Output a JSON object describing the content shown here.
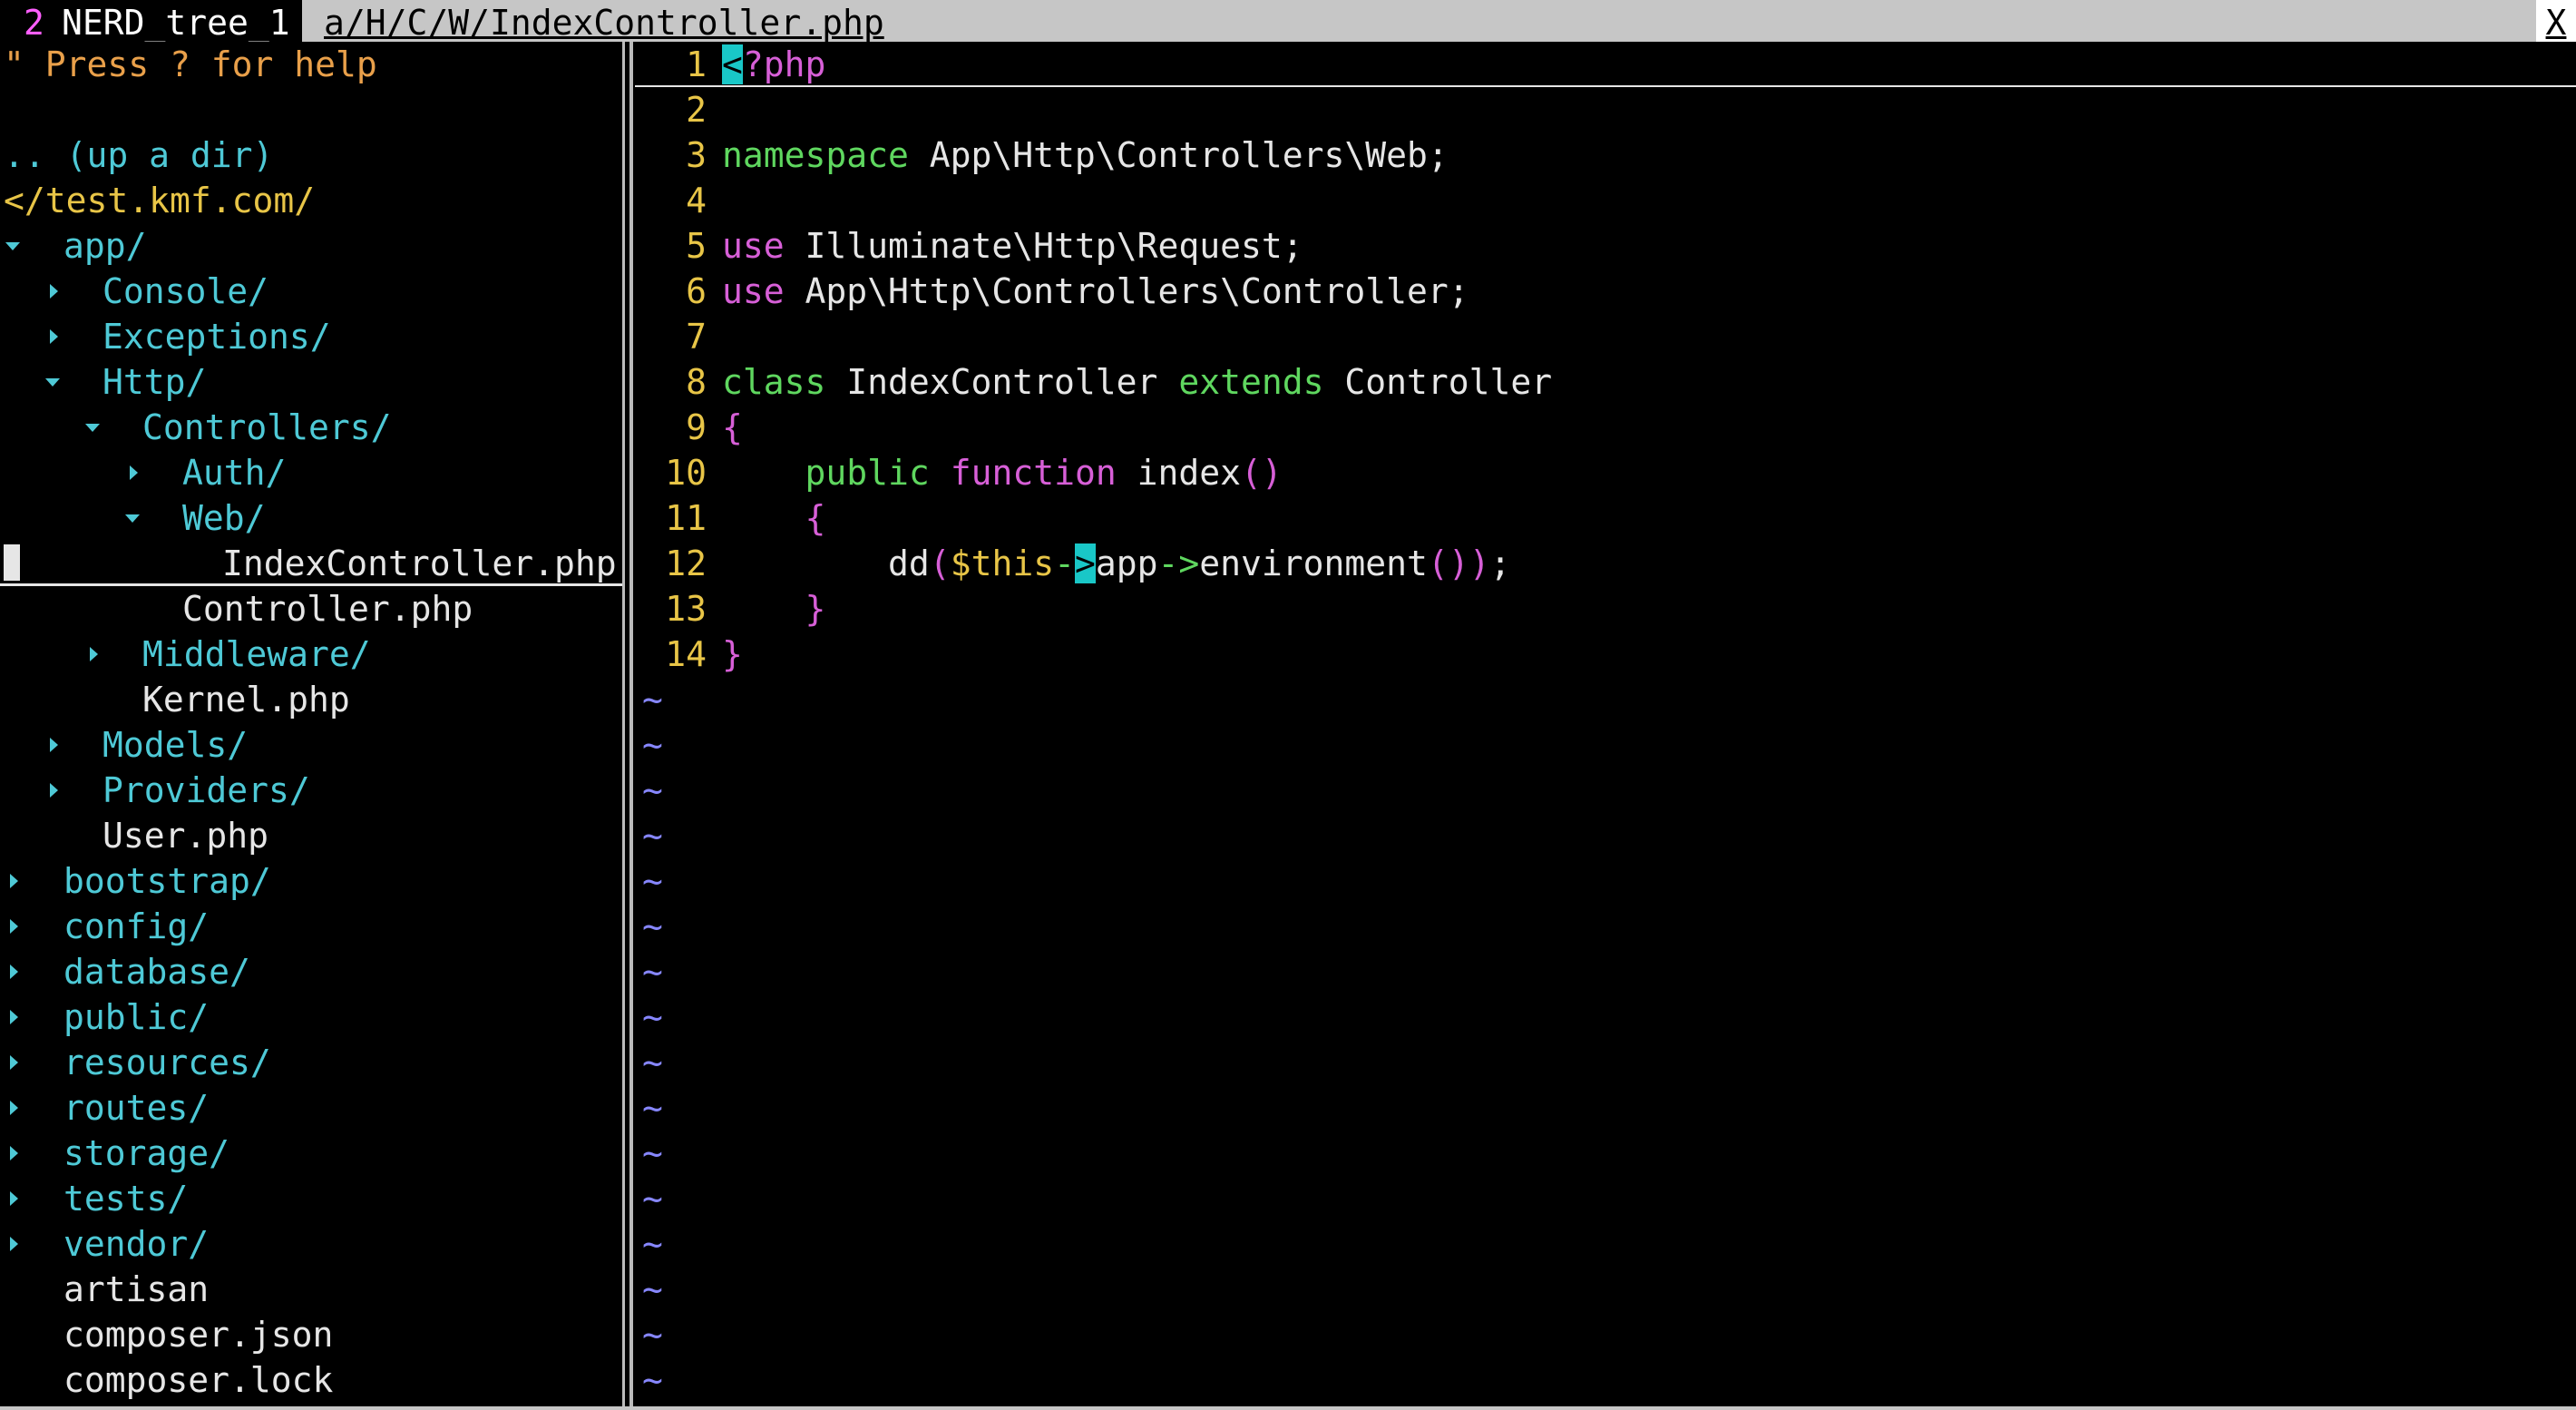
{
  "tabline": {
    "tab1_number": "2",
    "tab1_label": "NERD_tree_1",
    "tab2_label": "a/H/C/W/IndexController.php",
    "close_label": "X"
  },
  "nerdtree": {
    "help": "\" Press ? for help",
    "up_dir": ".. (up a dir)",
    "root": "</test.kmf.com/",
    "items": [
      {
        "label": "app/",
        "type": "dir",
        "state": "open"
      },
      {
        "label": "Console/",
        "type": "dir",
        "state": "closed"
      },
      {
        "label": "Exceptions/",
        "type": "dir",
        "state": "closed"
      },
      {
        "label": "Http/",
        "type": "dir",
        "state": "open"
      },
      {
        "label": "Controllers/",
        "type": "dir",
        "state": "open"
      },
      {
        "label": "Auth/",
        "type": "dir",
        "state": "closed"
      },
      {
        "label": "Web/",
        "type": "dir",
        "state": "open"
      },
      {
        "label": "IndexController.php",
        "type": "file",
        "selected": true
      },
      {
        "label": "Controller.php",
        "type": "file"
      },
      {
        "label": "Middleware/",
        "type": "dir",
        "state": "closed"
      },
      {
        "label": "Kernel.php",
        "type": "file"
      },
      {
        "label": "Models/",
        "type": "dir",
        "state": "closed"
      },
      {
        "label": "Providers/",
        "type": "dir",
        "state": "closed"
      },
      {
        "label": "User.php",
        "type": "file"
      },
      {
        "label": "bootstrap/",
        "type": "dir",
        "state": "closed"
      },
      {
        "label": "config/",
        "type": "dir",
        "state": "closed"
      },
      {
        "label": "database/",
        "type": "dir",
        "state": "closed"
      },
      {
        "label": "public/",
        "type": "dir",
        "state": "closed"
      },
      {
        "label": "resources/",
        "type": "dir",
        "state": "closed"
      },
      {
        "label": "routes/",
        "type": "dir",
        "state": "closed"
      },
      {
        "label": "storage/",
        "type": "dir",
        "state": "closed"
      },
      {
        "label": "tests/",
        "type": "dir",
        "state": "closed"
      },
      {
        "label": "vendor/",
        "type": "dir",
        "state": "closed"
      },
      {
        "label": "artisan",
        "type": "file"
      },
      {
        "label": "composer.json",
        "type": "file"
      },
      {
        "label": "composer.lock",
        "type": "file"
      }
    ]
  },
  "editor": {
    "line_numbers": [
      "1",
      "2",
      "3",
      "4",
      "5",
      "6",
      "7",
      "8",
      "9",
      "10",
      "11",
      "12",
      "13",
      "14"
    ],
    "code": {
      "l1_lt": "<",
      "l1_php": "?php",
      "l3_kw": "namespace",
      "l3_rest": " App\\Http\\Controllers\\Web;",
      "l5_kw": "use",
      "l5_rest": " Illuminate\\Http\\Request;",
      "l6_kw": "use",
      "l6_rest": " App\\Http\\Controllers\\Controller;",
      "l8_kw": "class",
      "l8_name": " IndexController ",
      "l8_ext": "extends",
      "l8_parent": " Controller",
      "l9": "{",
      "l10_indent": "    ",
      "l10_public": "public",
      "l10_sp": " ",
      "l10_function": "function",
      "l10_name": " index",
      "l10_parens": "()",
      "l11_indent": "    ",
      "l11_brace": "{",
      "l12_indent": "        ",
      "l12_dd": "dd",
      "l12_open": "(",
      "l12_dollar": "$",
      "l12_this": "this",
      "l12_dash": "-",
      "l12_gt": ">",
      "l12_app": "app",
      "l12_arrow": "->",
      "l12_env": "environment",
      "l12_parens": "())",
      "l12_semi": ";",
      "l13_indent": "    ",
      "l13_brace": "}",
      "l14": "}"
    },
    "tilde": "~",
    "tilde_count": 16
  },
  "colors": {
    "directory": "#4ec9d6",
    "file": "#e6e6e6",
    "help": "#e9a04a",
    "root": "#e8c547",
    "keyword_green": "#5fd75f",
    "keyword_magenta": "#d75fd7",
    "line_number": "#e8c547",
    "tilde": "#8787ff"
  }
}
